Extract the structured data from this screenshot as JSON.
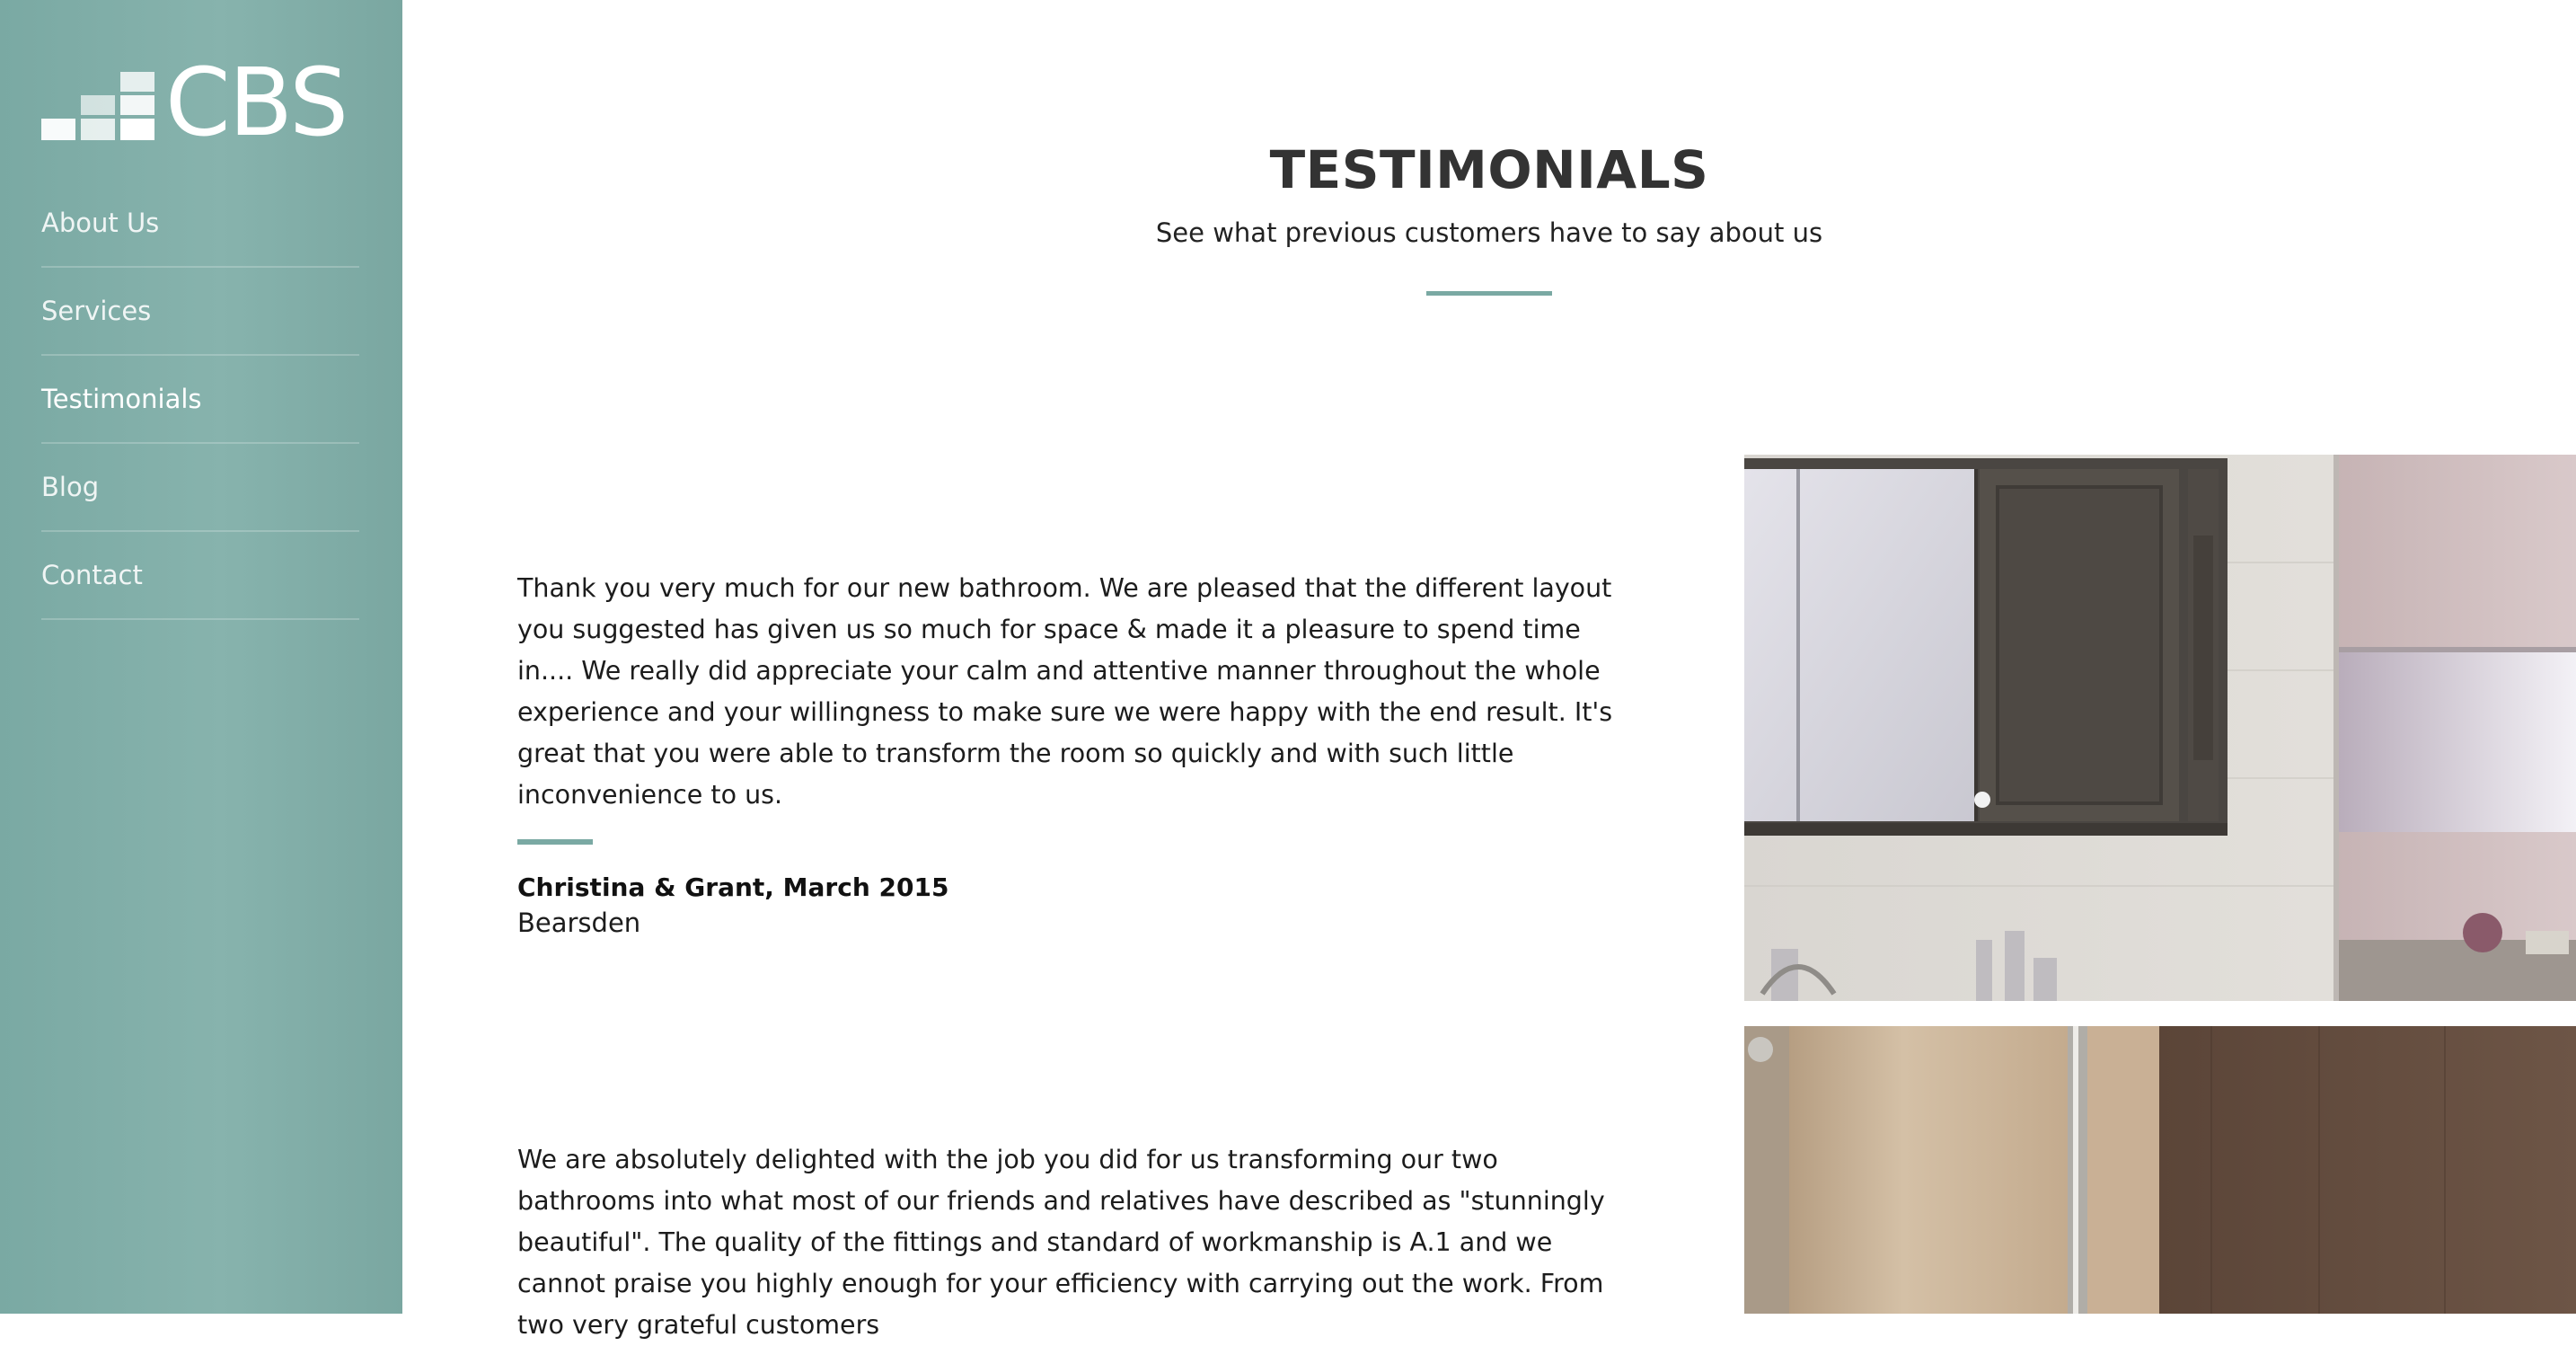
{
  "brand": {
    "logo_text": "CBS"
  },
  "nav": {
    "items": [
      {
        "label": "About Us",
        "active": false
      },
      {
        "label": "Services",
        "active": false
      },
      {
        "label": "Testimonials",
        "active": true
      },
      {
        "label": "Blog",
        "active": false
      },
      {
        "label": "Contact",
        "active": false
      }
    ]
  },
  "page": {
    "title": "TESTIMONIALS",
    "subtitle": "See what previous customers have to say about us"
  },
  "testimonials": [
    {
      "quote": "Thank you very much for our new bathroom. We are pleased that the different layout you suggested has given us so much for space & made it a pleasure to spend time in.... We really did appreciate your calm and attentive manner throughout the whole experience and your willingness to make sure we were happy with the end result. It's great that you were able to transform the room so quickly and with such little inconvenience to us.",
      "author": "Christina & Grant, March 2015",
      "location": "Bearsden"
    },
    {
      "quote": "We are absolutely delighted with the job you did for us transforming our two bathrooms into what most of our friends and relatives have described as \"stunningly beautiful\". The quality of the fittings and standard of workmanship is A.1 and we cannot praise you highly enough for your efficiency with carrying out the work. From two very grateful customers"
    }
  ],
  "colors": {
    "sidebar": "#87b3ad",
    "accent": "#7aa9a3",
    "heading": "#333333"
  }
}
